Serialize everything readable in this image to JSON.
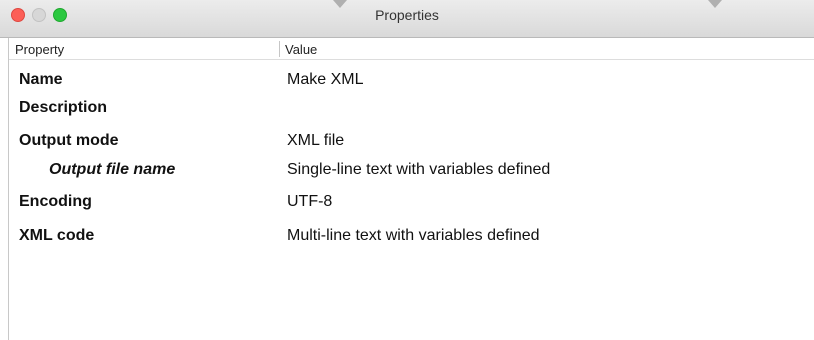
{
  "window": {
    "title": "Properties",
    "colors": {
      "close": "#fc5f57",
      "minimize": "#d7d7d7",
      "zoom": "#2bc840"
    }
  },
  "table": {
    "headers": {
      "property": "Property",
      "value": "Value"
    },
    "rows": [
      {
        "name": "Name",
        "value": "Make XML"
      },
      {
        "name": "Description",
        "value": ""
      },
      {
        "name": "Output mode",
        "value": "XML file"
      },
      {
        "name": "Output file name",
        "value": "Single-line text with variables defined"
      },
      {
        "name": "Encoding",
        "value": "UTF-8"
      },
      {
        "name": "XML code",
        "value": "Multi-line text with variables defined"
      }
    ]
  }
}
